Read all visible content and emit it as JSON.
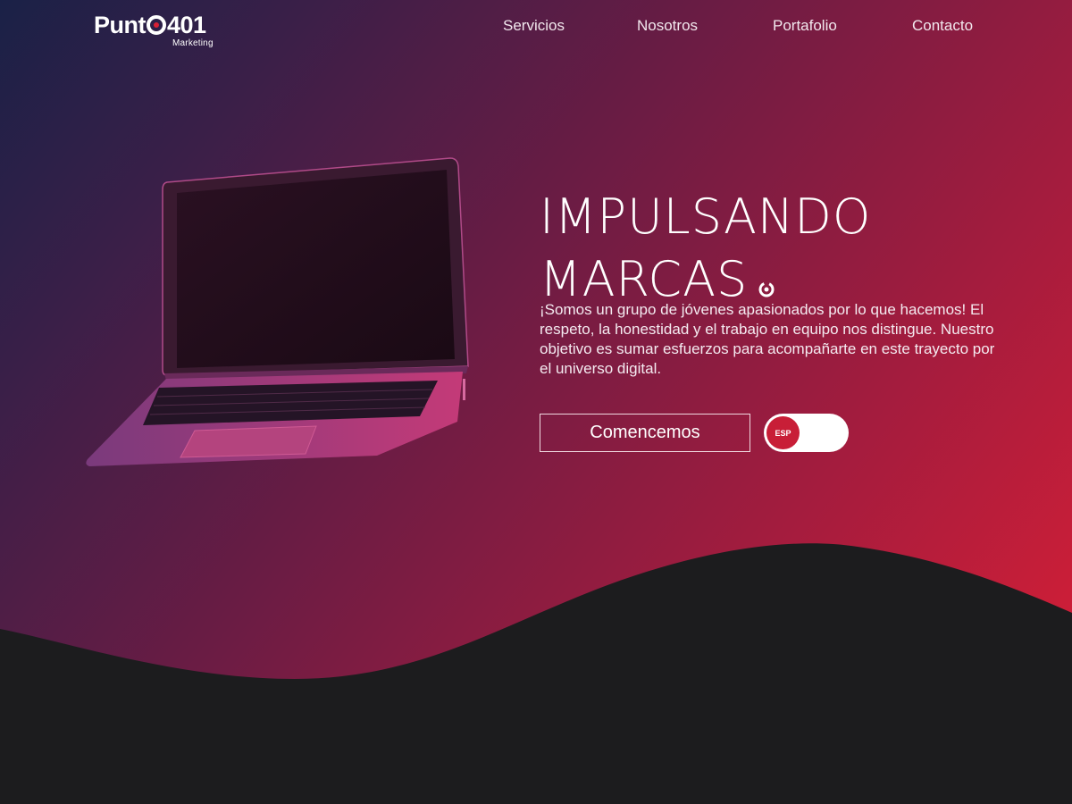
{
  "brand": {
    "name_left": "Punt",
    "name_right": "401",
    "subtitle": "Marketing"
  },
  "nav": {
    "items": [
      "Servicios",
      "Nosotros",
      "Portafolio",
      "Contacto"
    ]
  },
  "hero": {
    "headline_line1": "IMPULSANDO",
    "headline_line2": "MARCAS",
    "description": "¡Somos un grupo de jóvenes apasionados por lo que hacemos! El respeto, la honestidad y el trabajo en equipo nos distingue. Nuestro objetivo es sumar esfuerzos para acompañarte en este trayecto por el universo digital.",
    "cta_label": "Comencemos",
    "language_toggle_label": "ESP"
  },
  "colors": {
    "accent": "#d91f35",
    "gradient_start": "#1a2147",
    "gradient_end": "#dd1f35",
    "wave": "#1c1c1e"
  }
}
